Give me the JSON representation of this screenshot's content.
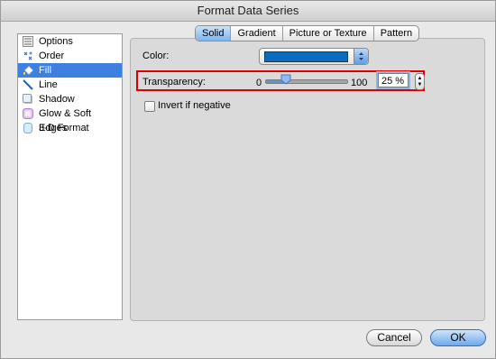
{
  "window": {
    "title": "Format Data Series"
  },
  "sidebar": {
    "items": [
      {
        "label": "Options",
        "icon": "options-icon",
        "selected": false
      },
      {
        "label": "Order",
        "icon": "order-icon",
        "selected": false
      },
      {
        "label": "Fill",
        "icon": "fill-bucket-icon",
        "selected": true
      },
      {
        "label": "Line",
        "icon": "line-icon",
        "selected": false
      },
      {
        "label": "Shadow",
        "icon": "shadow-icon",
        "selected": false
      },
      {
        "label": "Glow & Soft Edges",
        "icon": "glow-icon",
        "selected": false
      },
      {
        "label": "3-D Format",
        "icon": "3d-format-icon",
        "selected": false
      }
    ]
  },
  "tabs": [
    {
      "label": "Solid",
      "active": true
    },
    {
      "label": "Gradient",
      "active": false
    },
    {
      "label": "Picture or Texture",
      "active": false
    },
    {
      "label": "Pattern",
      "active": false
    }
  ],
  "fill": {
    "color_label": "Color:",
    "color_value": "#0a6dbf",
    "transparency_label": "Transparency:",
    "slider_min": "0",
    "slider_max": "100",
    "transparency_value": "25 %",
    "transparency_fraction": 0.25,
    "invert_label": "Invert if negative",
    "invert_checked": false
  },
  "footer": {
    "cancel_label": "Cancel",
    "ok_label": "OK"
  },
  "colors": {
    "accent": "#3d80df",
    "highlight_box": "#d80000"
  }
}
